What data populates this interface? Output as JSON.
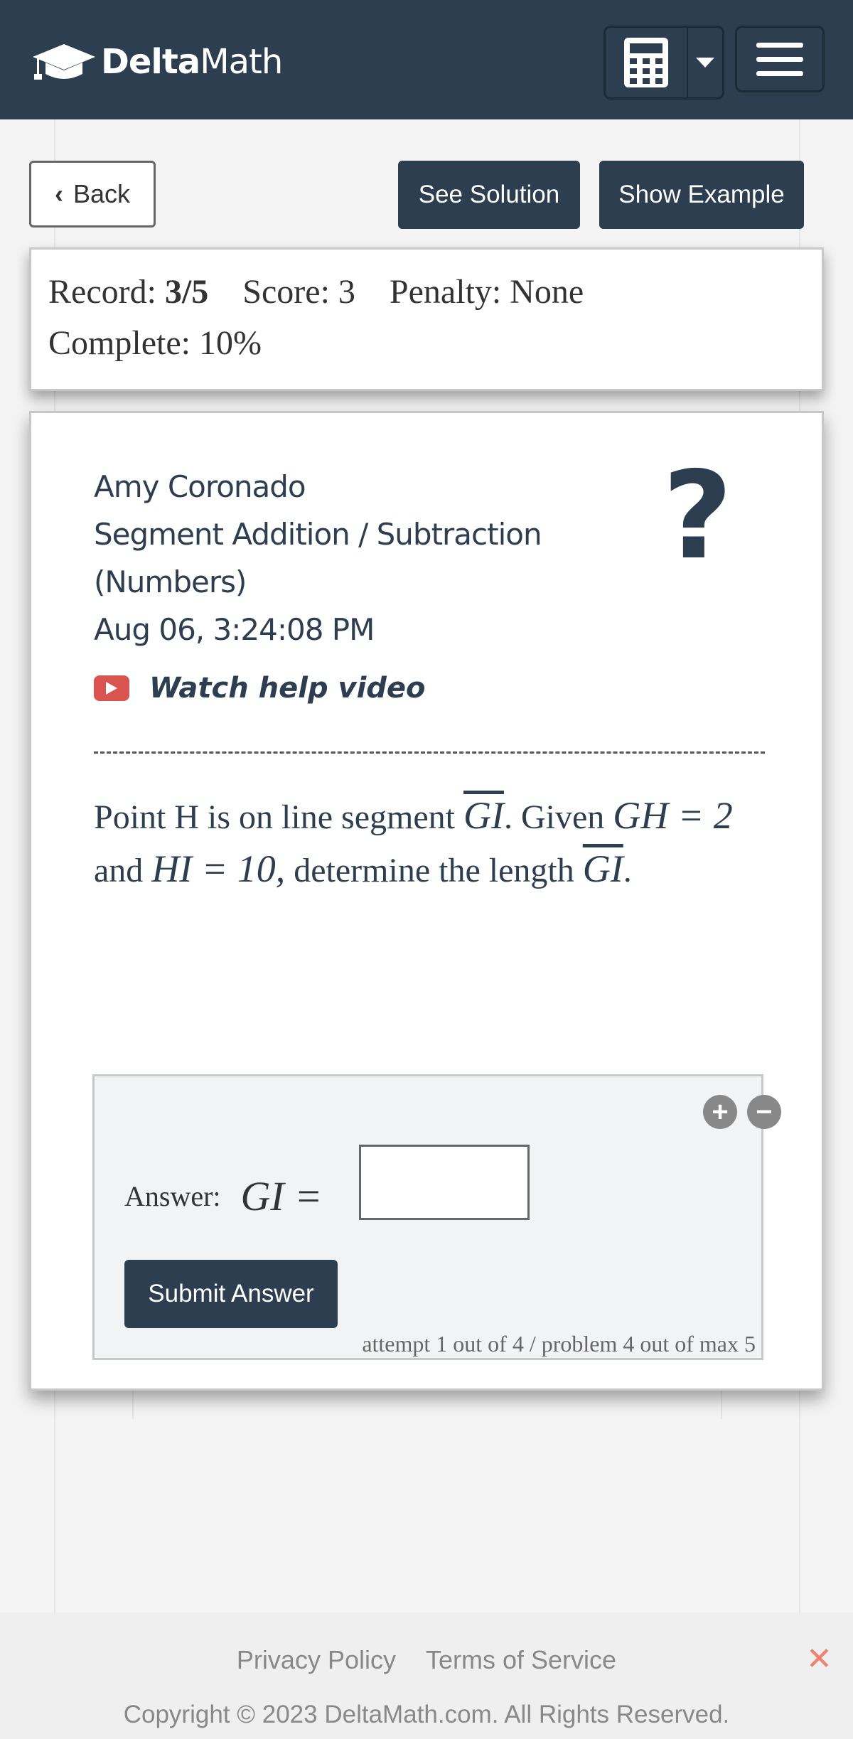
{
  "navbar": {
    "brand_bold": "Delta",
    "brand_rest": "Math"
  },
  "actions": {
    "back_label": "Back",
    "see_solution_label": "See Solution",
    "show_example_label": "Show Example"
  },
  "record": {
    "record_label": "Record:",
    "record_value": "3/5",
    "score_label": "Score:",
    "score_value": "3",
    "penalty_label": "Penalty:",
    "penalty_value": "None",
    "complete_label": "Complete:",
    "complete_value": "10%"
  },
  "problem": {
    "student_name": "Amy Coronado",
    "topic_line1": "Segment Addition / Subtraction",
    "topic_line2": "(Numbers)",
    "timestamp": "Aug 06, 3:24:08 PM",
    "help_icon": "?",
    "watch_video_label": "Watch help video",
    "question": {
      "part1": "Point H is on line segment ",
      "seg1": "GI",
      "part2": ". Given ",
      "eq1": "GH = 2",
      "part3": " and ",
      "eq2": "HI = 10,",
      "part4": " determine the length ",
      "seg2": "GI",
      "part5": "."
    }
  },
  "answer": {
    "label": "Answer:",
    "expression": "GI =",
    "input_value": "",
    "submit_label": "Submit Answer",
    "attempt_text": "attempt 1 out of 4 / problem 4 out of max 5"
  },
  "footer": {
    "privacy": "Privacy Policy",
    "terms": "Terms of Service",
    "copyright": "Copyright © 2023 DeltaMath.com. All Rights Reserved."
  },
  "colors": {
    "navbar": "#2c3e50",
    "button_dark": "#2c3e50",
    "youtube_red": "#d9534f",
    "close_x": "#f08070"
  }
}
